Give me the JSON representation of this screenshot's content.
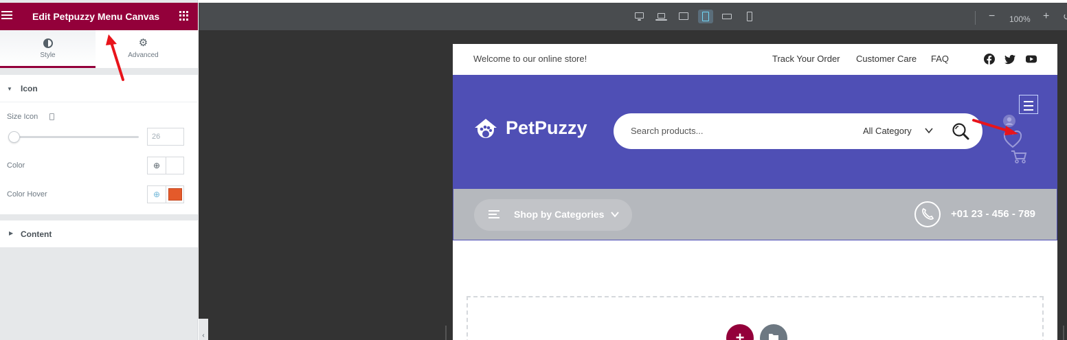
{
  "panel": {
    "title": "Edit Petpuzzy Menu Canvas",
    "tabs": [
      {
        "label": "Style",
        "icon": "half-circle-icon",
        "active": true
      },
      {
        "label": "Advanced",
        "icon": "gear-icon",
        "active": false
      }
    ],
    "icon_section": {
      "title": "Icon",
      "size_label": "Size Icon",
      "size_value": "26",
      "size_slider_fraction": 0.05,
      "color_label": "Color",
      "color_value": "#ffffff",
      "color_hover_label": "Color Hover",
      "color_hover_value": "#e45a2a"
    },
    "content_section": {
      "title": "Content"
    }
  },
  "toolbar": {
    "devices": [
      "desktop-icon",
      "laptop-icon",
      "tablet-landscape-icon",
      "tablet-icon",
      "mobile-landscape-icon",
      "mobile-icon"
    ],
    "active_device": "tablet-icon",
    "zoom_out": "−",
    "zoom_level": "100%",
    "zoom_in": "+",
    "zoom_reset": "↺"
  },
  "site": {
    "topbar": {
      "welcome": "Welcome to our online store!",
      "links": [
        "Track Your Order",
        "Customer Care",
        "FAQ"
      ],
      "social": [
        "facebook-icon",
        "twitter-icon",
        "youtube-icon"
      ]
    },
    "header": {
      "logo_text": "PetPuzzy",
      "search_placeholder": "Search products...",
      "search_category": "All Category"
    },
    "navbar": {
      "category_label": "Shop by Categories",
      "phone": "+01 23 - 456 - 789"
    }
  },
  "colors": {
    "brand": "#93003a",
    "header_bg": "#4f4fb5",
    "nav_bg": "#b5b8bd",
    "annotation_arrow": "#e8141b"
  }
}
